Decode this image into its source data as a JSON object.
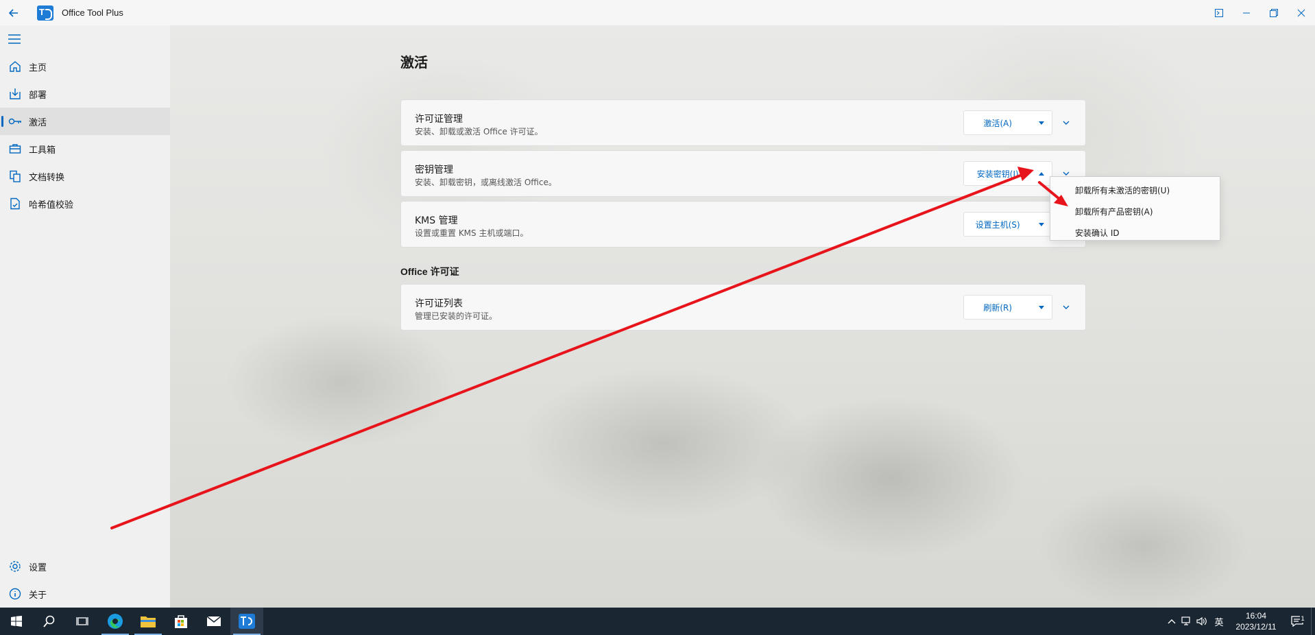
{
  "window": {
    "title": "Office Tool Plus"
  },
  "sidebar": {
    "items": [
      {
        "label": "主页",
        "icon": "home-icon"
      },
      {
        "label": "部署",
        "icon": "deploy-icon"
      },
      {
        "label": "激活",
        "icon": "key-icon",
        "active": true
      },
      {
        "label": "工具箱",
        "icon": "toolbox-icon"
      },
      {
        "label": "文档转换",
        "icon": "document-convert-icon"
      },
      {
        "label": "哈希值校验",
        "icon": "hash-check-icon"
      }
    ],
    "bottom": [
      {
        "label": "设置",
        "icon": "gear-icon"
      },
      {
        "label": "关于",
        "icon": "info-icon"
      }
    ]
  },
  "main": {
    "title": "激活",
    "cards": [
      {
        "title": "许可证管理",
        "desc": "安装、卸载或激活 Office 许可证。",
        "button": "激活(A)"
      },
      {
        "title": "密钥管理",
        "desc": "安装、卸载密钥，或离线激活 Office。",
        "button": "安装密钥(I)"
      },
      {
        "title": "KMS 管理",
        "desc": "设置或重置 KMS 主机或端口。",
        "button": "设置主机(S)"
      }
    ],
    "section_title": "Office 许可证",
    "section_cards": [
      {
        "title": "许可证列表",
        "desc": "管理已安装的许可证。",
        "button": "刷新(R)"
      }
    ]
  },
  "menu": {
    "items": [
      "卸载所有未激活的密钥(U)",
      "卸载所有产品密钥(A)",
      "安装确认 ID"
    ]
  },
  "taskbar": {
    "lang": "英",
    "time": "16:04",
    "date": "2023/12/11",
    "notification_count": "1"
  },
  "colors": {
    "accent": "#0067c0",
    "annotation": "#e8141b",
    "taskbar": "#1b2633"
  }
}
